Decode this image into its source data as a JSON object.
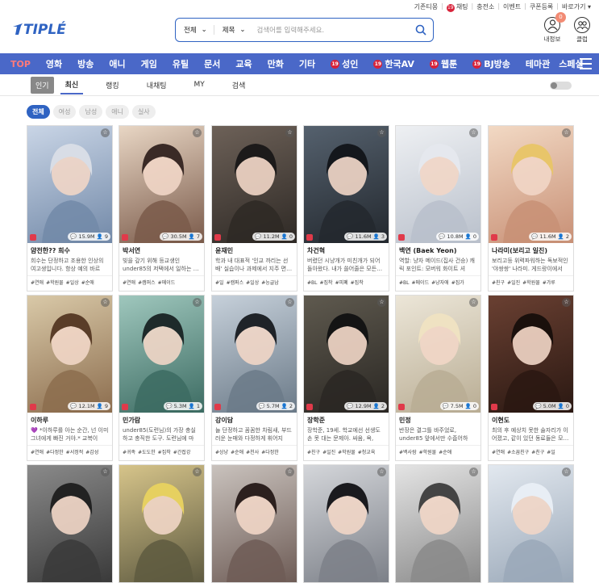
{
  "top_links": [
    "기존티몽",
    "채팅",
    "충전소",
    "이벤트",
    "쿠폰등록",
    "바로가기 ▾"
  ],
  "logo": {
    "text": "TIPLÉ"
  },
  "search": {
    "scope": "전체",
    "field": "제목",
    "placeholder": "검색어를 입력해주세요."
  },
  "header_icons": {
    "myinfo": "내정보",
    "myinfo_count": "0",
    "club": "클럽"
  },
  "nav": {
    "top": "TOP",
    "items": [
      "영화",
      "방송",
      "애니",
      "게임",
      "유틸",
      "문서",
      "교육",
      "만화",
      "기타"
    ],
    "adult": [
      "성인",
      "한국AV",
      "웹툰",
      "BJ방송"
    ],
    "tail": [
      "테마관",
      "스페셜"
    ],
    "badge": "19"
  },
  "subnav": {
    "tabs": [
      "인기",
      "최신",
      "랭킹",
      "내채팅",
      "MY",
      "검색"
    ],
    "active": "최신"
  },
  "filters": [
    "전체",
    "여성",
    "남성",
    "애니",
    "실사"
  ],
  "cards": [
    {
      "name": "얌전한?? 희수",
      "desc": "희수는 단정하고 조용한 인상의 여고생입니다. 항상 예의 바르게…",
      "views": "15.9M",
      "chats": "9",
      "tags": [
        "#연애",
        "#학원물",
        "#일상",
        "#순애"
      ],
      "c1": "#c9d5e6",
      "c2": "#7289a8",
      "hair": "#d8dde6"
    },
    {
      "name": "박서연",
      "desc": "빚을 갚기 위해 등교생인 under85의 저택에서 일하는 …",
      "views": "30.5M",
      "chats": "7",
      "tags": [
        "#연애",
        "#캠퍼스",
        "#메이드"
      ],
      "c1": "#e8d6c4",
      "c2": "#7a5a4a",
      "hair": "#3a2a26"
    },
    {
      "name": "윤재민",
      "desc": "학과 내 대표적 '인교 까리는 선배' 실습이나 과제에서 지주 면…",
      "views": "11.2M",
      "chats": "0",
      "tags": [
        "#일",
        "#캠퍼스",
        "#일상",
        "#능글남"
      ],
      "c1": "#6d6158",
      "c2": "#2e2925",
      "hair": "#1c1a1a"
    },
    {
      "name": "차건혁",
      "desc": "버렸던 시냥개가 미친개가 되어 돌아왔다. 내가 쓸어줄은 모든…",
      "views": "11.6M",
      "chats": "3",
      "tags": [
        "#BL",
        "#집착",
        "#피폐",
        "#집착"
      ],
      "c1": "#55616e",
      "c2": "#23282e",
      "hair": "#14171c"
    },
    {
      "name": "백연 (Baek Yeon)",
      "desc": "역할: 냥자 메이드(집사 건승) 캐릭 포인트: 모버워 화이트 셔츠,…",
      "views": "10.8M",
      "chats": "0",
      "tags": [
        "#BL",
        "#메이드",
        "#냥자애",
        "#집가"
      ],
      "c1": "#eef0f3",
      "c2": "#b9c0cb",
      "hair": "#e5e8ee"
    },
    {
      "name": "나라미(보리고 일진)",
      "desc": "보리고등 위력파워하는 독보적인 '야쌍쌍' 나라미. 게드랑이에서 …",
      "views": "11.6M",
      "chats": "2",
      "tags": [
        "#친구",
        "#일진",
        "#학원물",
        "#갸루"
      ],
      "c1": "#f2d9c4",
      "c2": "#c89076",
      "hair": "#e8c56a"
    },
    {
      "name": "이하루",
      "desc": "💜 *이하루를 아는 순간, 넌 이미 그녀에게 빠진 거야.* 교복이 내…",
      "views": "12.1M",
      "chats": "9",
      "tags": [
        "#연애",
        "#다정한",
        "#서정적",
        "#감성"
      ],
      "c1": "#d9c9a8",
      "c2": "#8c6d4e",
      "hair": "#5a3d28"
    },
    {
      "name": "민가람",
      "desc": "under85(도련님)의 가장 충실하고 충직한 도구. 도련님에 마다…",
      "views": "5.3M",
      "chats": "1",
      "tags": [
        "#귀족",
        "#도도한",
        "#집착",
        "#간접강"
      ],
      "c1": "#9fc7bd",
      "c2": "#3c6b62",
      "hair": "#1e2a2a"
    },
    {
      "name": "강이담",
      "desc": "늘 단정하고 꼼꼼한 차림새, 부드러운 눈매와 다정하게 휘어지는…",
      "views": "5.7M",
      "chats": "2",
      "tags": [
        "#상냥",
        "#순애",
        "#천사",
        "#다정한"
      ],
      "c1": "#c6d0da",
      "c2": "#6b7a88",
      "hair": "#1f2328"
    },
    {
      "name": "장학준",
      "desc": "장학준, 19세. 학교에선 선생도 손 못 대는 문제아. 싸움, 욕, 무…",
      "views": "12.9M",
      "chats": "2",
      "tags": [
        "#친구",
        "#일진",
        "#학원물",
        "#청교육"
      ],
      "c1": "#5f5a4f",
      "c2": "#2a2723",
      "hair": "#141414"
    },
    {
      "name": "민정",
      "desc": "반장은 결그틀 바주었로, under85 앞에서만 수줍어하니…",
      "views": "7.5M",
      "chats": "0",
      "tags": [
        "#백사람",
        "#학원물",
        "#순애"
      ],
      "c1": "#ece6d8",
      "c2": "#b9ad94",
      "hair": "#efe2c2"
    },
    {
      "name": "이현도",
      "desc": "최의 후 예상치 못한 술자리가 이어졌고, 같이 있던 동료들은 모…",
      "views": "5.0M",
      "chats": "0",
      "tags": [
        "#연애",
        "#소꿉친구",
        "#친구",
        "#일"
      ],
      "c1": "#6a4032",
      "c2": "#2a1812",
      "hair": "#1a100c"
    },
    {
      "name": "",
      "desc": "",
      "views": "",
      "chats": "",
      "tags": [],
      "c1": "#8a8a8a",
      "c2": "#3a3a3a",
      "hair": "#222"
    },
    {
      "name": "",
      "desc": "",
      "views": "",
      "chats": "",
      "tags": [],
      "c1": "#d6c48a",
      "c2": "#5e5a40",
      "hair": "#e6d060"
    },
    {
      "name": "",
      "desc": "",
      "views": "",
      "chats": "",
      "tags": [],
      "c1": "#c9c2bd",
      "c2": "#6e5c56",
      "hair": "#2c201e"
    },
    {
      "name": "",
      "desc": "",
      "views": "",
      "chats": "",
      "tags": [],
      "c1": "#d4d6da",
      "c2": "#7c8088",
      "hair": "#1a1a1e"
    },
    {
      "name": "",
      "desc": "",
      "views": "",
      "chats": "",
      "tags": [],
      "c1": "#e4e4e4",
      "c2": "#8a8a8a",
      "hair": "#444"
    },
    {
      "name": "",
      "desc": "",
      "views": "",
      "chats": "",
      "tags": [],
      "c1": "#e2e8ef",
      "c2": "#9aa8b8",
      "hair": "#e8eef5"
    }
  ]
}
